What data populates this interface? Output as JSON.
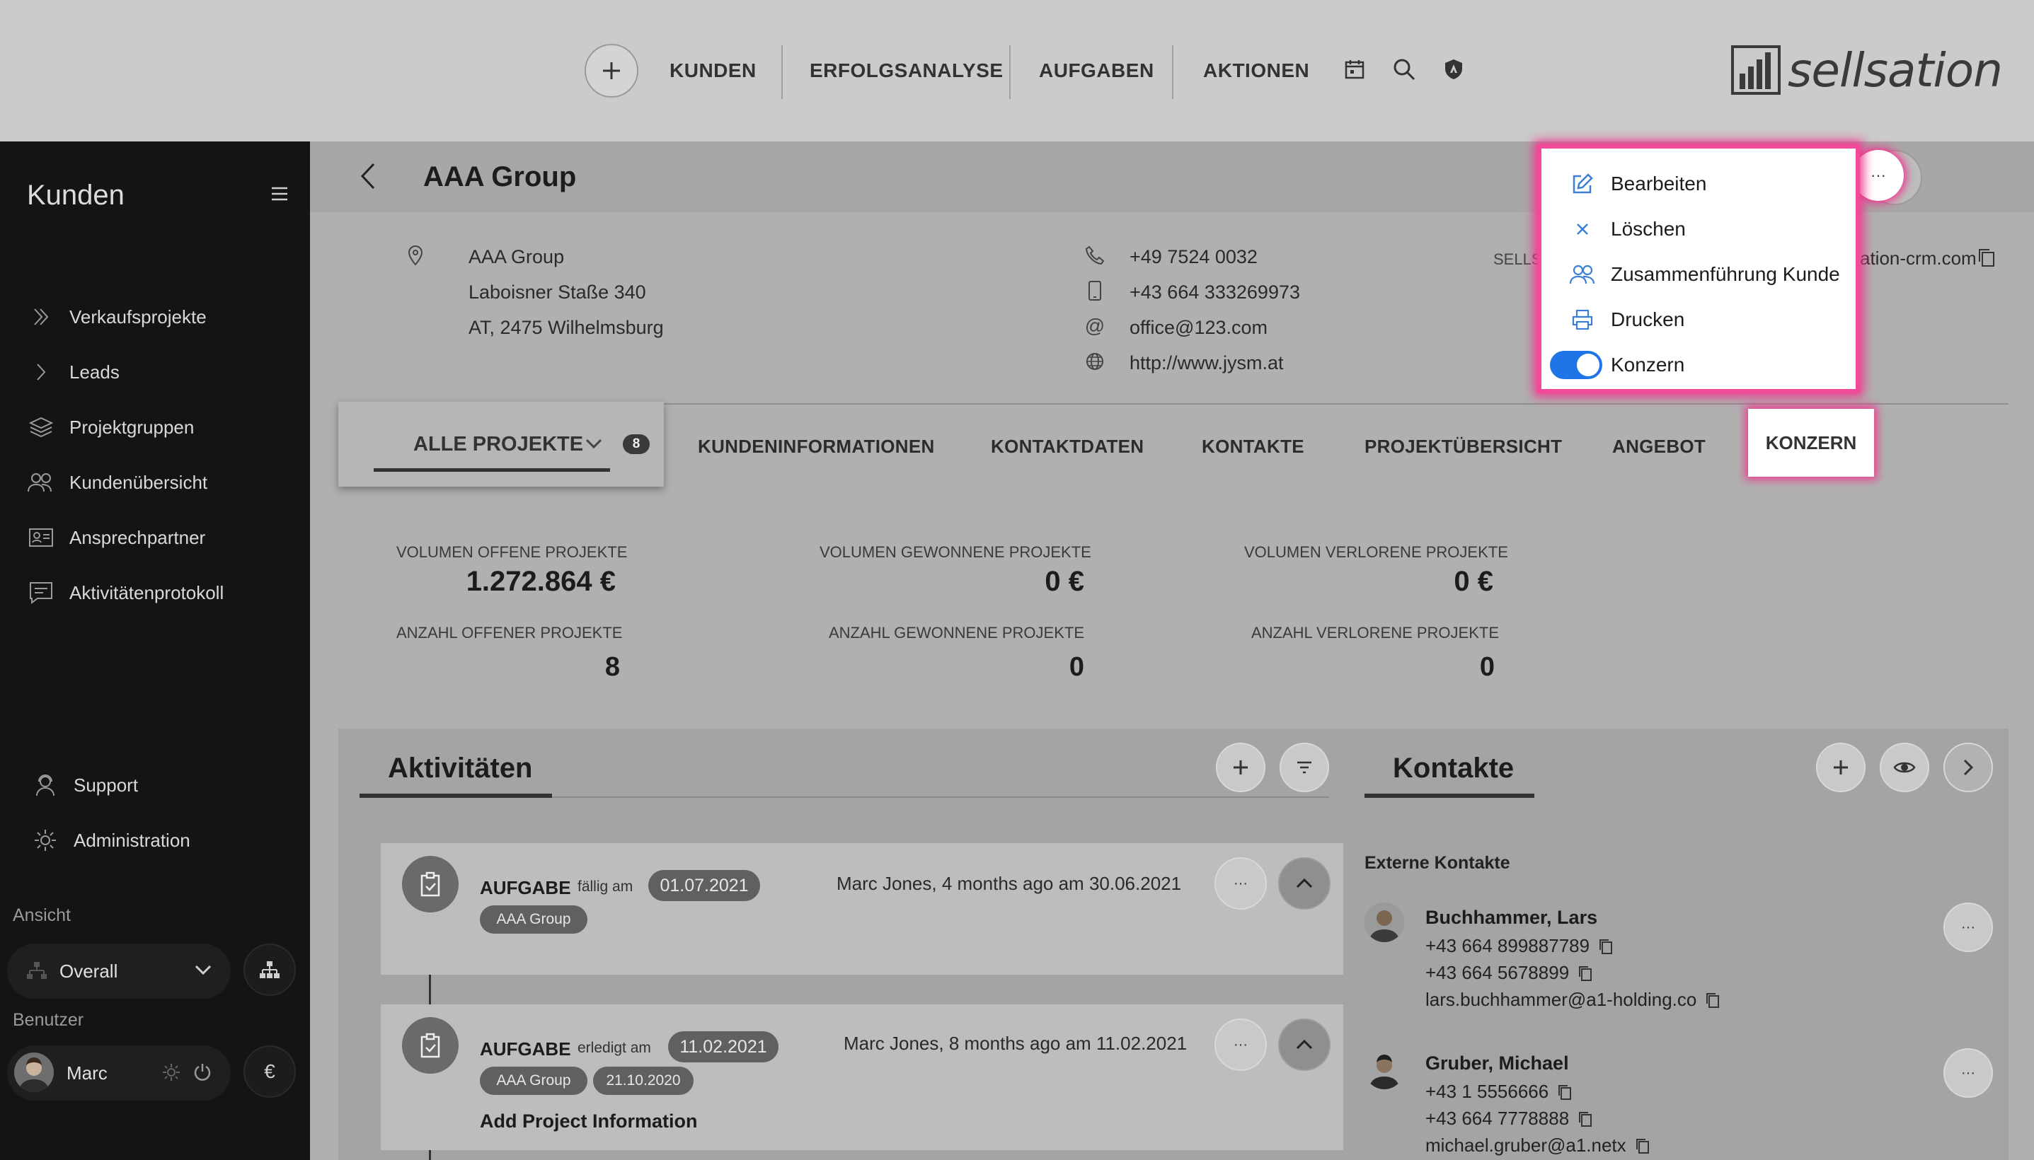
{
  "topnav": {
    "items": [
      "KUNDEN",
      "ERFOLGSANALYSE",
      "AUFGABEN",
      "AKTIONEN"
    ],
    "logo_text": "sellsation"
  },
  "sidebar": {
    "title": "Kunden",
    "items": [
      "Verkaufsprojekte",
      "Leads",
      "Projektgruppen",
      "Kundenübersicht",
      "Ansprechpartner",
      "Aktivitätenprotokoll"
    ],
    "support": "Support",
    "administration": "Administration",
    "view_label": "Ansicht",
    "view_value": "Overall",
    "user_label": "Benutzer",
    "user_name": "Marc",
    "currency": "€"
  },
  "header": {
    "title": "AAA Group"
  },
  "customer": {
    "name": "AAA Group",
    "street": "Laboisner Staße 340",
    "city": "AT, 2475 Wilhelmsburg",
    "phone": "+49 7524 0032",
    "mobile": "+43 664 333269973",
    "email": "office@123.com",
    "web": "http://www.jysm.at",
    "right_label": "SELLSA",
    "right_value": "ation-crm.com"
  },
  "tabs": {
    "all_projects": "ALLE PROJEKTE",
    "all_projects_count": "8",
    "items": [
      "KUNDENINFORMATIONEN",
      "KONTAKTDATEN",
      "KONTAKTE",
      "PROJEKTÜBERSICHT",
      "ANGEBOT"
    ],
    "konzern": "KONZERN"
  },
  "stats": {
    "open_volume_label": "VOLUMEN OFFENE PROJEKTE",
    "open_volume": "1.272.864 €",
    "won_volume_label": "VOLUMEN GEWONNENE PROJEKTE",
    "won_volume": "0 €",
    "lost_volume_label": "VOLUMEN VERLORENE PROJEKTE",
    "lost_volume": "0 €",
    "open_count_label": "ANZAHL OFFENER PROJEKTE",
    "open_count": "8",
    "won_count_label": "ANZAHL GEWONNENE PROJEKTE",
    "won_count": "0",
    "lost_count_label": "ANZAHL VERLORENE PROJEKTE",
    "lost_count": "0"
  },
  "activities": {
    "title": "Aktivitäten",
    "items": [
      {
        "type": "AUFGABE",
        "date_label": "fällig am",
        "date": "01.07.2021",
        "tag": "AAA Group",
        "meta": "Marc Jones, 4 months ago am 30.06.2021"
      },
      {
        "type": "AUFGABE",
        "date_label": "erledigt am",
        "date": "11.02.2021",
        "tag": "AAA Group",
        "tag2": "21.10.2020",
        "meta": "Marc Jones, 8 months ago am 11.02.2021",
        "subject": "Add Project Information"
      }
    ]
  },
  "contacts": {
    "title": "Kontakte",
    "section": "Externe Kontakte",
    "items": [
      {
        "name": "Buchhammer, Lars",
        "phone": "+43 664 899887789",
        "mobile": "+43 664 5678899",
        "email": "lars.buchhammer@a1-holding.co"
      },
      {
        "name": "Gruber, Michael",
        "phone": "+43 1 5556666",
        "mobile": "+43 664 7778888",
        "email": "michael.gruber@a1.netx"
      }
    ]
  },
  "menu": {
    "items": [
      "Bearbeiten",
      "Löschen",
      "Zusammenführung Kunde",
      "Drucken"
    ],
    "toggle_label": "Konzern",
    "toggle_on": true
  },
  "colors": {
    "accent_pink": "#f0378f",
    "toggle_blue": "#1f74e8",
    "sidebar_bg": "#141414"
  }
}
